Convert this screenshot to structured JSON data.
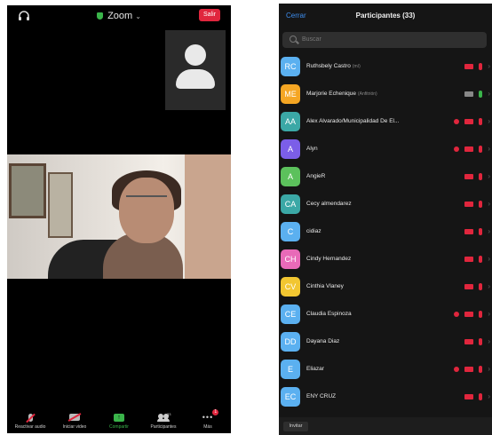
{
  "meeting": {
    "title": "Zoom",
    "leave_label": "Salir",
    "toolbar": {
      "audio_label": "Reactivar audio",
      "video_label": "Iniciar video",
      "share_label": "Compartir",
      "participants_label": "Participantes",
      "participants_count": "33",
      "more_label": "Más",
      "more_badge": "1"
    }
  },
  "participants": {
    "close_label": "Cerrar",
    "title": "Participantes (33)",
    "search_placeholder": "Buscar",
    "invite_label": "Invitar",
    "list": [
      {
        "initials": "RC",
        "name": "Ruthsbely Castro",
        "tag": "(mí)"
      },
      {
        "initials": "ME",
        "name": "Marjorie Echenique",
        "tag": "(Anfitrión)"
      },
      {
        "initials": "AA",
        "name": "Alex Alvarado/Municipalidad De El...",
        "tag": ""
      },
      {
        "initials": "A",
        "name": "Alyn",
        "tag": ""
      },
      {
        "initials": "A",
        "name": "AngieR",
        "tag": ""
      },
      {
        "initials": "CA",
        "name": "Cecy almendarez",
        "tag": ""
      },
      {
        "initials": "C",
        "name": "cidiaz",
        "tag": ""
      },
      {
        "initials": "CH",
        "name": "Cindy Hernandez",
        "tag": ""
      },
      {
        "initials": "CV",
        "name": "Cinthia Vlaney",
        "tag": ""
      },
      {
        "initials": "CE",
        "name": "Claudia Espinoza",
        "tag": ""
      },
      {
        "initials": "DD",
        "name": "Dayana Diaz",
        "tag": ""
      },
      {
        "initials": "E",
        "name": "Eliazar",
        "tag": ""
      },
      {
        "initials": "EC",
        "name": "ENY CRUZ",
        "tag": ""
      }
    ]
  },
  "colors": {
    "accent_blue": "#3d8ef0",
    "leave_red": "#e0263d",
    "muted_red": "#e0263d",
    "active_green": "#3ab44a"
  }
}
